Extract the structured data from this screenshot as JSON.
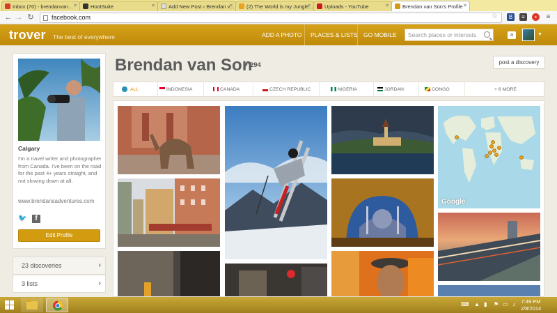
{
  "browser": {
    "tabs": [
      {
        "label": "Inbox (70) - brendanvan...",
        "favicon_color": "#d93b2b",
        "active": false
      },
      {
        "label": "HootSuite",
        "favicon_color": "#333333",
        "active": false
      },
      {
        "label": "Add New Post ‹ Brendan v...",
        "favicon_color": "#888888",
        "active": false
      },
      {
        "label": "(2) The World is my Jungle...",
        "favicon_color": "#3b5998",
        "active": false
      },
      {
        "label": "Uploads - YouTube",
        "favicon_color": "#cc181e",
        "active": false
      },
      {
        "label": "Brendan van Son's Profile",
        "favicon_color": "#d39c10",
        "active": true
      }
    ],
    "url": "facebook.com"
  },
  "header": {
    "logo": "trover",
    "tagline": "The best of everywhere",
    "nav": [
      "ADD A PHOTO",
      "PLACES & LISTS",
      "GO MOBILE"
    ],
    "search_placeholder": "Search places or interests",
    "user_badge": "a"
  },
  "profile": {
    "city": "Calgary",
    "bio": "I'm a travel writer and photographer from Canada. I've been on the road for the past 4+ years straight, and not slowing down at all.",
    "website": "www.brendansadventures.com",
    "edit_label": "Edit Profile",
    "stats": [
      {
        "count": "23",
        "label": "discoveries"
      },
      {
        "count": "3",
        "label": "lists"
      }
    ]
  },
  "main": {
    "name": "Brendan van Son",
    "likes": "294",
    "post_label": "post a discovery",
    "filters": [
      {
        "label": "ALL",
        "flag": [
          "#2a8fb8"
        ]
      },
      {
        "label": "INDONESIA",
        "flag": [
          "#e4002b",
          "#ffffff"
        ]
      },
      {
        "label": "CANADA",
        "flag": [
          "#e4002b",
          "#ffffff",
          "#e4002b"
        ]
      },
      {
        "label": "CZECH REPUBLIC",
        "flag": [
          "#ffffff",
          "#d7141a",
          "#11457e"
        ]
      },
      {
        "label": "NIGERIA",
        "flag": [
          "#008751",
          "#ffffff",
          "#008751"
        ]
      },
      {
        "label": "JORDAN",
        "flag": [
          "#000000",
          "#ffffff",
          "#007a3d"
        ]
      },
      {
        "label": "CONGO",
        "flag": [
          "#009543",
          "#fbde4a",
          "#dc241f"
        ]
      },
      {
        "label": "+ 6 MORE",
        "flag": []
      }
    ],
    "map_brand": "Google"
  },
  "taskbar": {
    "time": "7:49 PM",
    "date": "2/8/2014"
  }
}
